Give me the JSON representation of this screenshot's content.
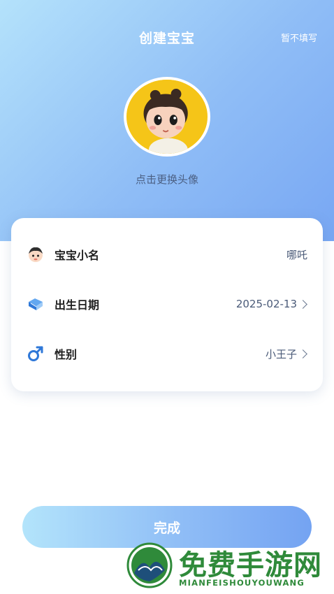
{
  "header": {
    "title": "创建宝宝",
    "skip_label": "暂不填写"
  },
  "avatar": {
    "hint": "点击更换头像",
    "background_color": "#f5c518"
  },
  "form": {
    "rows": [
      {
        "icon": "baby-face-icon",
        "label": "宝宝小名",
        "value": "哪吒"
      },
      {
        "icon": "calendar-book-icon",
        "label": "出生日期",
        "value": "2025-02-13"
      },
      {
        "icon": "male-symbol-icon",
        "label": "性别",
        "value": "小王子"
      }
    ]
  },
  "footer": {
    "done_label": "完成"
  },
  "watermark": {
    "title": "免费手游网",
    "subtitle": "MIANFEISHOUYOUWANG"
  },
  "colors": {
    "accent": "#78a7f3",
    "watermark_green": "#2f8a3a"
  }
}
